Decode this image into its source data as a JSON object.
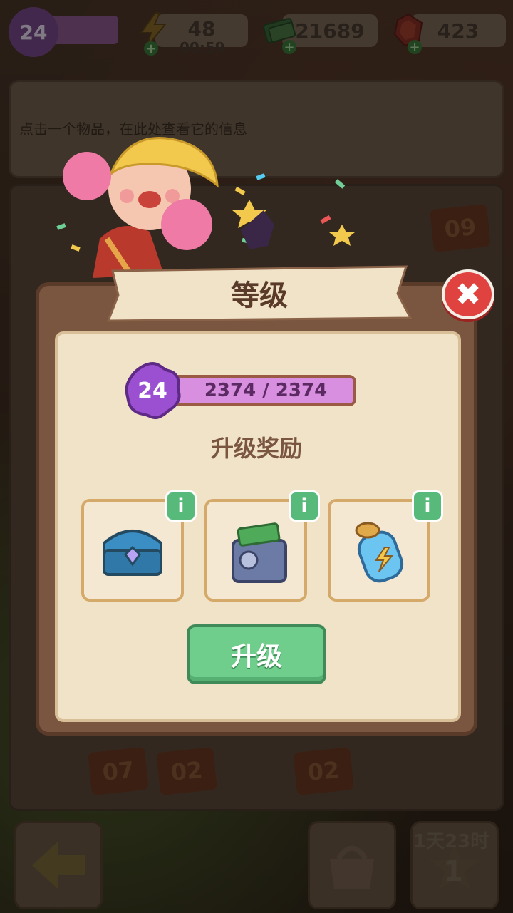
{
  "topbar": {
    "player_level": "24",
    "energy": "48",
    "energy_timer": "00:59",
    "cash": "21689",
    "gems": "423",
    "icons": [
      "lightning-icon",
      "cash-icon",
      "gem-icon"
    ]
  },
  "info_panel": {
    "hint": "点击一个物品，在此处查看它的信息"
  },
  "board_tiles": [
    "09",
    "07",
    "02",
    "02"
  ],
  "dialog": {
    "title": "等级",
    "level": "24",
    "xp_text": "2374 / 2374",
    "xp_fraction": 1.0,
    "reward_heading": "升级奖励",
    "rewards": [
      {
        "item": "treasure-chest-icon",
        "info": "i"
      },
      {
        "item": "cash-safe-icon",
        "info": "i"
      },
      {
        "item": "energy-jar-icon",
        "info": "i"
      }
    ],
    "upgrade_label": "升级",
    "close_symbol": "✖"
  },
  "bottom": {
    "timer": "1天23时",
    "star_count": "1"
  },
  "colors": {
    "accent_purple": "#d88fe0",
    "button_green": "#6fce8c",
    "close_red": "#e0423f",
    "panel_cream": "#f1e3c8"
  }
}
